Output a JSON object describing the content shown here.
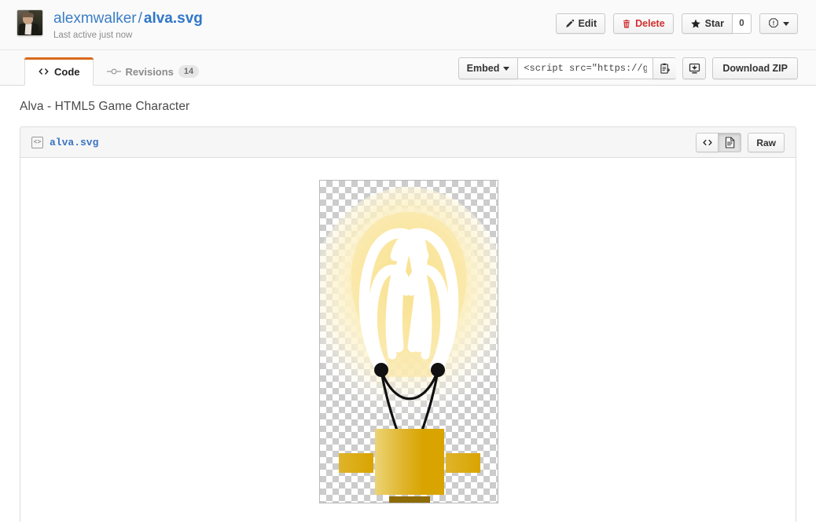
{
  "header": {
    "owner": "alexmwalker",
    "separator": "/",
    "gist_name": "alva.svg",
    "last_active": "Last active just now",
    "avatar_name": "user-avatar",
    "actions": {
      "edit": "Edit",
      "delete": "Delete",
      "star": "Star",
      "star_count": "0",
      "info_caret": "▾"
    }
  },
  "tabs": [
    {
      "label": "Code",
      "icon": "code-icon",
      "badge": "",
      "active": true
    },
    {
      "label": "Revisions",
      "icon": "commit-node-icon",
      "badge": "14",
      "active": false
    }
  ],
  "embed": {
    "dropdown_label": "Embed",
    "value": "<script src=\"https://gi",
    "placeholder": "<script src=\"https://gi",
    "copy_icon": "clipboard-copy-icon",
    "download_icon": "download-icon",
    "download_zip": "Download ZIP"
  },
  "gist": {
    "description": "Alva - HTML5 Game Character",
    "file": {
      "name": "alva.svg",
      "icon": "code-file-icon",
      "view_code_label": "<>",
      "view_preview_label": "preview",
      "raw_label": "Raw",
      "active_view": "preview"
    }
  },
  "preview": {
    "alt": "Alva light bulb character SVG",
    "colors": {
      "glow_outer": "#fdf6dc",
      "glow_inner": "#f8e28c",
      "filament": "#ffffff",
      "base_light": "#e9c95c",
      "base_dark": "#d9a400",
      "base_shadow": "#8a6a05",
      "wire": "#111111",
      "checker": "#cccccc"
    }
  },
  "theme": {
    "accent_orange": "#d96a1d",
    "link_blue": "#3b7ec4",
    "danger_red": "#cf2f2f",
    "page_bg": "#ffffff",
    "bar_bg": "#fafafa"
  }
}
